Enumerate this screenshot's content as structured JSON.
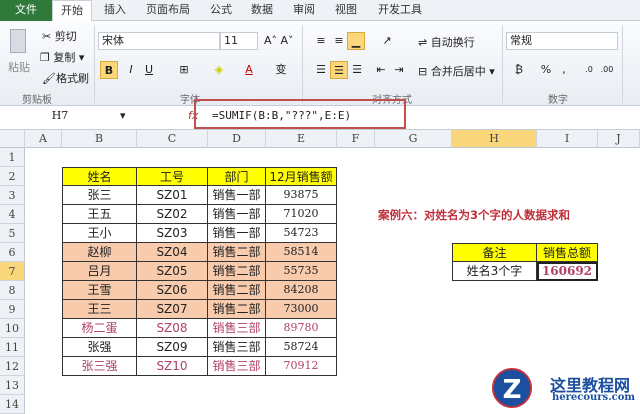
{
  "tabs": [
    "文件",
    "开始",
    "插入",
    "页面布局",
    "公式",
    "数据",
    "审阅",
    "视图",
    "开发工具"
  ],
  "clipboard": {
    "paste": "粘贴",
    "cut": "剪切",
    "copy": "复制",
    "format_painter": "格式刷",
    "label": "剪贴板"
  },
  "font": {
    "name": "宋体",
    "size": "11",
    "bold": "B",
    "italic": "I",
    "underline": "U",
    "label": "字体"
  },
  "alignment": {
    "wrap": "自动换行",
    "merge": "合并后居中",
    "label": "对齐方式"
  },
  "number": {
    "format": "常规",
    "percent": "%",
    "comma": ",",
    "label": "数字"
  },
  "formula_bar": {
    "name_box": "H7",
    "fx": "fx",
    "formula": "=SUMIF(B:B,\"???\",E:E)"
  },
  "columns": [
    "A",
    "B",
    "C",
    "D",
    "E",
    "F",
    "G",
    "H",
    "I",
    "J"
  ],
  "rows": [
    "1",
    "2",
    "3",
    "4",
    "5",
    "6",
    "7",
    "8",
    "9",
    "10",
    "11",
    "12",
    "13",
    "14"
  ],
  "table": {
    "headers": [
      "姓名",
      "工号",
      "部门",
      "12月销售额"
    ],
    "rows": [
      [
        "张三",
        "SZ01",
        "销售一部",
        "93875"
      ],
      [
        "王五",
        "SZ02",
        "销售一部",
        "71020"
      ],
      [
        "王小",
        "SZ03",
        "销售一部",
        "54723"
      ],
      [
        "赵柳",
        "SZ04",
        "销售二部",
        "58514"
      ],
      [
        "吕月",
        "SZ05",
        "销售二部",
        "55735"
      ],
      [
        "王雪",
        "SZ06",
        "销售二部",
        "84208"
      ],
      [
        "王三",
        "SZ07",
        "销售二部",
        "73000"
      ],
      [
        "杨二蛋",
        "SZ08",
        "销售三部",
        "89780"
      ],
      [
        "张强",
        "SZ09",
        "销售三部",
        "58724"
      ],
      [
        "张三强",
        "SZ10",
        "销售三部",
        "70912"
      ]
    ]
  },
  "case_title": "案例六：对姓名为3个字的人数据求和",
  "summary": {
    "headers": [
      "备注",
      "销售总额"
    ],
    "label": "姓名3个字",
    "value": "160692"
  },
  "watermark": {
    "name": "这里教程网",
    "url": "herecours.com"
  }
}
